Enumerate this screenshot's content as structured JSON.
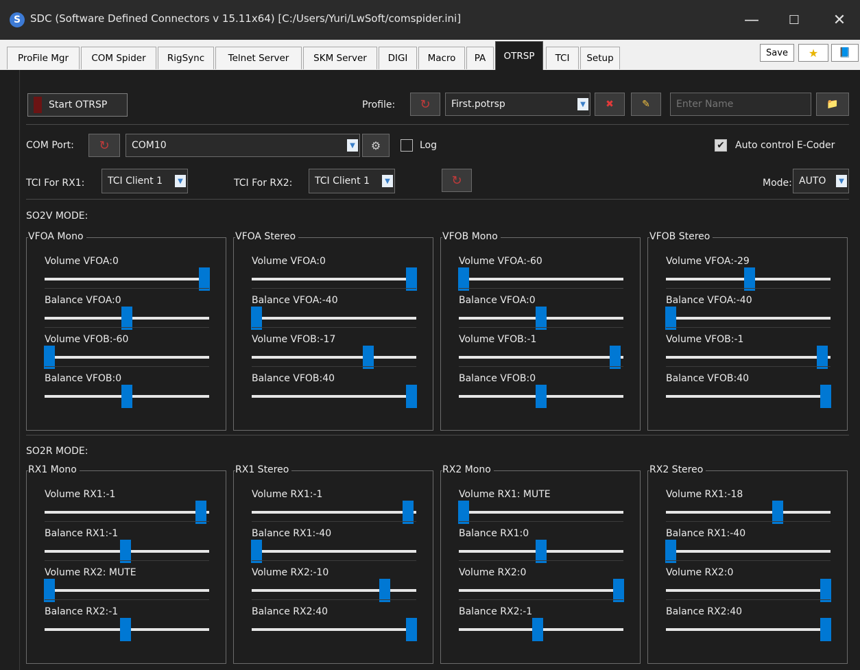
{
  "window": {
    "icon_letter": "S",
    "title": "SDC (Software Defined Connectors v 15.11x64) [C:/Users/Yuri/LwSoft/comspider.ini]",
    "minimize": "—",
    "maximize": "☐",
    "close": "✕"
  },
  "tabs": [
    {
      "label": "ProFile Mgr"
    },
    {
      "label": "COM Spider"
    },
    {
      "label": "RigSync"
    },
    {
      "label": "Telnet Server"
    },
    {
      "label": "SKM Server"
    },
    {
      "label": "DIGI"
    },
    {
      "label": "Macro"
    },
    {
      "label": "PA"
    },
    {
      "label": "OTRSP",
      "active": true
    },
    {
      "label": "TCI"
    },
    {
      "label": "Setup"
    }
  ],
  "toolbar": {
    "save_label": "Save",
    "star_icon": "★",
    "book_icon": "📘"
  },
  "otrsp": {
    "start_label": "Start OTRSP",
    "profile_label": "Profile:",
    "profile_value": "First.potrsp",
    "name_placeholder": "Enter Name",
    "com_port_label": "COM Port:",
    "com_port_value": "COM10",
    "log_label": "Log",
    "log_checked": false,
    "auto_control_label": "Auto control E-Coder",
    "auto_control_checked": true,
    "tci_rx1_label": "TCI For RX1:",
    "tci_rx1_value": "TCI Client 1",
    "tci_rx2_label": "TCI For RX2:",
    "tci_rx2_value": "TCI Client 1",
    "mode_label": "Mode:",
    "mode_value": "AUTO"
  },
  "so2v": {
    "title": "SO2V MODE:",
    "groups": [
      {
        "title": "VFOA Mono",
        "sliders": [
          {
            "label": "Volume VFOA:0",
            "pos": 0.97
          },
          {
            "label": "Balance VFOA:0",
            "pos": 0.5
          },
          {
            "label": "Volume VFOB:-60",
            "pos": 0.03
          },
          {
            "label": "Balance VFOB:0",
            "pos": 0.5
          }
        ]
      },
      {
        "title": "VFOA Stereo",
        "sliders": [
          {
            "label": "Volume VFOA:0",
            "pos": 0.97
          },
          {
            "label": "Balance VFOA:-40",
            "pos": 0.03
          },
          {
            "label": "Volume VFOB:-17",
            "pos": 0.71
          },
          {
            "label": "Balance VFOB:40",
            "pos": 0.97
          }
        ]
      },
      {
        "title": "VFOB Mono",
        "sliders": [
          {
            "label": "Volume VFOA:-60",
            "pos": 0.03
          },
          {
            "label": "Balance VFOA:0",
            "pos": 0.5
          },
          {
            "label": "Volume VFOB:-1",
            "pos": 0.95
          },
          {
            "label": "Balance VFOB:0",
            "pos": 0.5
          }
        ]
      },
      {
        "title": "VFOB Stereo",
        "sliders": [
          {
            "label": "Volume VFOA:-29",
            "pos": 0.51
          },
          {
            "label": "Balance VFOA:-40",
            "pos": 0.03
          },
          {
            "label": "Volume VFOB:-1",
            "pos": 0.95
          },
          {
            "label": "Balance VFOB:40",
            "pos": 0.97
          }
        ]
      }
    ]
  },
  "so2r": {
    "title": "SO2R MODE:",
    "groups": [
      {
        "title": "RX1 Mono",
        "sliders": [
          {
            "label": "Volume RX1:-1",
            "pos": 0.95
          },
          {
            "label": "Balance RX1:-1",
            "pos": 0.49
          },
          {
            "label": "Volume RX2: MUTE",
            "pos": 0.03
          },
          {
            "label": "Balance RX2:-1",
            "pos": 0.49
          }
        ]
      },
      {
        "title": "RX1 Stereo",
        "sliders": [
          {
            "label": "Volume RX1:-1",
            "pos": 0.95
          },
          {
            "label": "Balance RX1:-40",
            "pos": 0.03
          },
          {
            "label": "Volume RX2:-10",
            "pos": 0.81
          },
          {
            "label": "Balance RX2:40",
            "pos": 0.97
          }
        ]
      },
      {
        "title": "RX2 Mono",
        "sliders": [
          {
            "label": "Volume RX1: MUTE",
            "pos": 0.03
          },
          {
            "label": "Balance RX1:0",
            "pos": 0.5
          },
          {
            "label": "Volume RX2:0",
            "pos": 0.97
          },
          {
            "label": "Balance RX2:-1",
            "pos": 0.48
          }
        ]
      },
      {
        "title": "RX2 Stereo",
        "sliders": [
          {
            "label": "Volume RX1:-18",
            "pos": 0.68
          },
          {
            "label": "Balance RX1:-40",
            "pos": 0.03
          },
          {
            "label": "Volume RX2:0",
            "pos": 0.97
          },
          {
            "label": "Balance RX2:40",
            "pos": 0.97
          }
        ]
      }
    ]
  }
}
